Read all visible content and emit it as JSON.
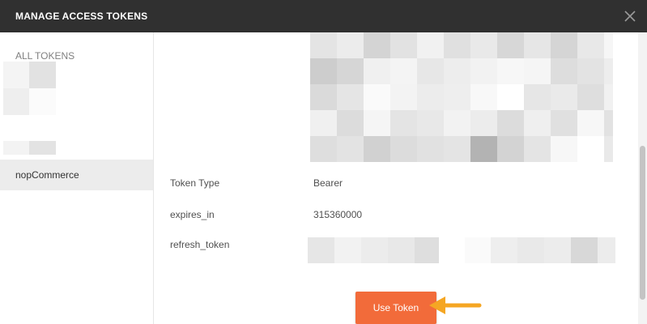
{
  "dialog": {
    "title": "MANAGE ACCESS TOKENS",
    "close_icon": "close-icon"
  },
  "sidebar": {
    "section_label": "ALL TOKENS",
    "active_item": "nopCommerce"
  },
  "details": {
    "token_type_label": "Token Type",
    "token_type_value": "Bearer",
    "expires_in_label": "expires_in",
    "expires_in_value": "315360000",
    "refresh_token_label": "refresh_token"
  },
  "actions": {
    "use_token_label": "Use Token"
  },
  "colors": {
    "header_bg": "#303030",
    "accent": "#f26b3a",
    "arrow": "#f5a623",
    "selected_bg": "#ececec"
  }
}
